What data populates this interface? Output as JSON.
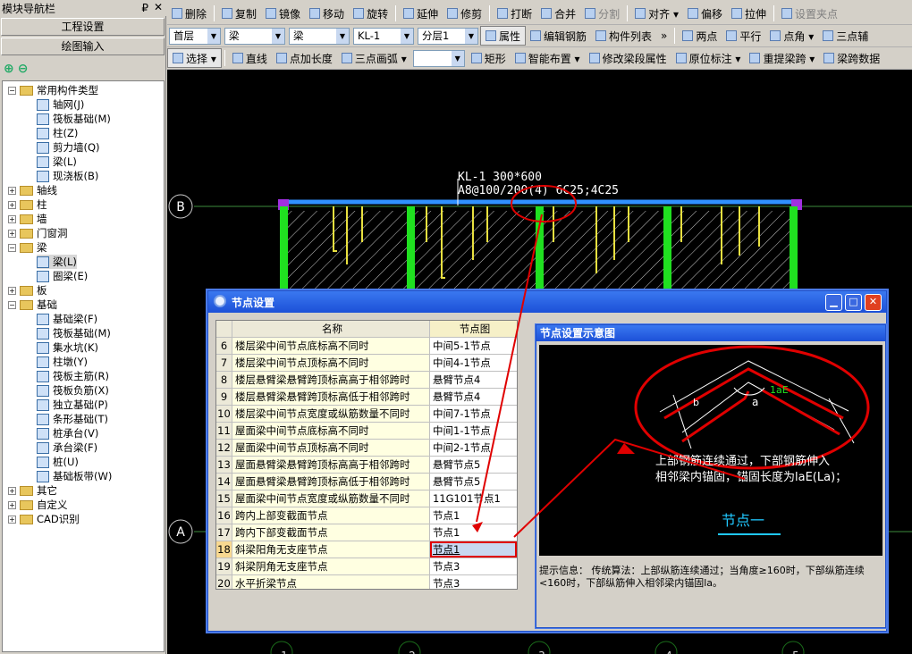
{
  "nav": {
    "title": "模块导航栏",
    "pin": "₽",
    "close": "✕",
    "project_settings": "工程设置",
    "drawing_input": "绘图输入",
    "tree": [
      {
        "label": "常用构件类型",
        "level": 0,
        "type": "folder",
        "expander": "−"
      },
      {
        "label": "轴网(J)",
        "level": 1,
        "type": "item"
      },
      {
        "label": "筏板基础(M)",
        "level": 1,
        "type": "item"
      },
      {
        "label": "柱(Z)",
        "level": 1,
        "type": "item"
      },
      {
        "label": "剪力墙(Q)",
        "level": 1,
        "type": "item"
      },
      {
        "label": "梁(L)",
        "level": 1,
        "type": "item"
      },
      {
        "label": "现浇板(B)",
        "level": 1,
        "type": "item"
      },
      {
        "label": "轴线",
        "level": 0,
        "type": "folder",
        "expander": "+"
      },
      {
        "label": "柱",
        "level": 0,
        "type": "folder",
        "expander": "+"
      },
      {
        "label": "墙",
        "level": 0,
        "type": "folder",
        "expander": "+"
      },
      {
        "label": "门窗洞",
        "level": 0,
        "type": "folder",
        "expander": "+"
      },
      {
        "label": "梁",
        "level": 0,
        "type": "folder",
        "expander": "−"
      },
      {
        "label": "梁(L)",
        "level": 1,
        "type": "item",
        "selected": true
      },
      {
        "label": "圈梁(E)",
        "level": 1,
        "type": "item"
      },
      {
        "label": "板",
        "level": 0,
        "type": "folder",
        "expander": "+"
      },
      {
        "label": "基础",
        "level": 0,
        "type": "folder",
        "expander": "−"
      },
      {
        "label": "基础梁(F)",
        "level": 1,
        "type": "item"
      },
      {
        "label": "筏板基础(M)",
        "level": 1,
        "type": "item"
      },
      {
        "label": "集水坑(K)",
        "level": 1,
        "type": "item"
      },
      {
        "label": "柱墩(Y)",
        "level": 1,
        "type": "item"
      },
      {
        "label": "筏板主筋(R)",
        "level": 1,
        "type": "item"
      },
      {
        "label": "筏板负筋(X)",
        "level": 1,
        "type": "item"
      },
      {
        "label": "独立基础(P)",
        "level": 1,
        "type": "item"
      },
      {
        "label": "条形基础(T)",
        "level": 1,
        "type": "item"
      },
      {
        "label": "桩承台(V)",
        "level": 1,
        "type": "item"
      },
      {
        "label": "承台梁(F)",
        "level": 1,
        "type": "item"
      },
      {
        "label": "桩(U)",
        "level": 1,
        "type": "item"
      },
      {
        "label": "基础板带(W)",
        "level": 1,
        "type": "item"
      },
      {
        "label": "其它",
        "level": 0,
        "type": "folder",
        "expander": "+"
      },
      {
        "label": "自定义",
        "level": 0,
        "type": "folder",
        "expander": "+"
      },
      {
        "label": "CAD识别",
        "level": 0,
        "type": "folder",
        "expander": "+"
      }
    ]
  },
  "toolbar1": [
    {
      "label": "删除",
      "icon": "delete-icon"
    },
    {
      "label": "复制",
      "icon": "copy-icon"
    },
    {
      "label": "镜像",
      "icon": "mirror-icon"
    },
    {
      "label": "移动",
      "icon": "move-icon"
    },
    {
      "label": "旋转",
      "icon": "rotate-icon"
    },
    {
      "label": "延伸",
      "icon": "extend-icon"
    },
    {
      "label": "修剪",
      "icon": "trim-icon"
    },
    {
      "label": "打断",
      "icon": "break-icon"
    },
    {
      "label": "合并",
      "icon": "merge-icon"
    },
    {
      "label": "分割",
      "icon": "split-icon",
      "disabled": true
    },
    {
      "label": "对齐 ▾",
      "icon": "align-icon"
    },
    {
      "label": "偏移",
      "icon": "offset-icon"
    },
    {
      "label": "拉伸",
      "icon": "stretch-icon"
    },
    {
      "label": "设置夹点",
      "icon": "grip-icon",
      "disabled": true
    }
  ],
  "toolbar2": {
    "floor": "首层",
    "category": "梁",
    "type": "梁",
    "component": "KL-1",
    "layer": "分层1",
    "buttons": [
      "属性",
      "编辑钢筋",
      "构件列表"
    ],
    "more": "»",
    "right": [
      "两点",
      "平行",
      "点角 ▾",
      "三点辅"
    ]
  },
  "toolbar3": [
    "选择 ▾",
    "直线",
    "点加长度",
    "三点画弧 ▾",
    "",
    "矩形",
    "智能布置 ▾",
    "修改梁段属性",
    "原位标注 ▾",
    "重提梁跨 ▾",
    "梁跨数据"
  ],
  "drawing": {
    "beam_label_line1": "KL-1 300*600",
    "beam_label_line2": "A8@100/200(4) 6C25;4C25",
    "axis_b": "B",
    "axis_a": "A",
    "axis_numbers": [
      "1",
      "2",
      "3",
      "4",
      "5"
    ]
  },
  "dialog": {
    "title": "节点设置",
    "col_name": "名称",
    "col_node": "节点图",
    "rows": [
      {
        "no": "6",
        "name": "楼层梁中间节点底标高不同时",
        "node": "中间5-1节点"
      },
      {
        "no": "7",
        "name": "楼层梁中间节点顶标高不同时",
        "node": "中间4-1节点"
      },
      {
        "no": "8",
        "name": "楼层悬臂梁悬臂跨顶标高高于相邻跨时",
        "node": "悬臂节点4"
      },
      {
        "no": "9",
        "name": "楼层悬臂梁悬臂跨顶标高低于相邻跨时",
        "node": "悬臂节点4"
      },
      {
        "no": "10",
        "name": "楼层梁中间节点宽度或纵筋数量不同时",
        "node": "中间7-1节点"
      },
      {
        "no": "11",
        "name": "屋面梁中间节点底标高不同时",
        "node": "中间1-1节点"
      },
      {
        "no": "12",
        "name": "屋面梁中间节点顶标高不同时",
        "node": "中间2-1节点"
      },
      {
        "no": "13",
        "name": "屋面悬臂梁悬臂跨顶标高高于相邻跨时",
        "node": "悬臂节点5"
      },
      {
        "no": "14",
        "name": "屋面悬臂梁悬臂跨顶标高低于相邻跨时",
        "node": "悬臂节点5"
      },
      {
        "no": "15",
        "name": "屋面梁中间节点宽度或纵筋数量不同时",
        "node": "11G101节点1"
      },
      {
        "no": "16",
        "name": "跨内上部变截面节点",
        "node": "节点1"
      },
      {
        "no": "17",
        "name": "跨内下部变截面节点",
        "node": "节点1"
      },
      {
        "no": "18",
        "name": "斜梁阳角无支座节点",
        "node": "节点1",
        "selected": true
      },
      {
        "no": "19",
        "name": "斜梁阴角无支座节点",
        "node": "节点3"
      },
      {
        "no": "20",
        "name": "水平折梁节点",
        "node": "节点3"
      }
    ],
    "preview_title": "节点设置示意图",
    "preview_desc_line1": "上部钢筋连续通过，下部钢筋伸入",
    "preview_desc_line2": "相邻梁内锚固，锚固长度为laE(La)；",
    "preview_caption": "节点一",
    "preview_lae": "1aE",
    "preview_a": "a",
    "preview_b": "b",
    "hint_label": "提示信息：",
    "hint_text": "传统算法：上部纵筋连续通过；当角度≥160时，下部纵筋连续<160时，下部纵筋伸入相邻梁内锚固la。"
  },
  "colors": {
    "highlight_red": "#e00000",
    "beam_green": "#20e020",
    "beam_blue": "#3090ff",
    "title_blue": "#1c50d8"
  }
}
